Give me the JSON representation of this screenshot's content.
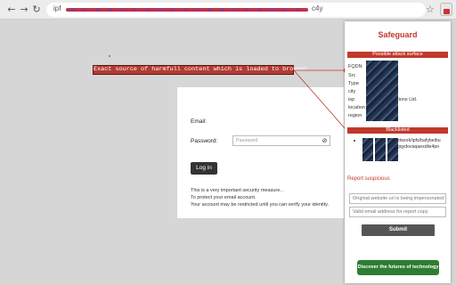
{
  "browser": {
    "back_icon": "back-arrow-icon",
    "forward_icon": "forward-arrow-icon",
    "reload_icon": "reload-icon",
    "address_prefix": "ipf",
    "address_suffix": "c4y",
    "star_icon": "star-icon",
    "extension_icon": "safeguard-extension-icon"
  },
  "overlay": {
    "banner_text": "Exact source of harmfull content which is loaded to browser",
    "banner_color": "#b33b32",
    "arrow_color": "#c0392b"
  },
  "login": {
    "email_label": "Email:",
    "password_label": "Password:",
    "password_placeholder": "Password",
    "eye_icon": "eye-slash-icon",
    "login_button": "Log in",
    "notice_lines": [
      "This is a very important security measure, .",
      "To protect your email account.",
      "Your account may be restricted until you can verify your identity."
    ]
  },
  "panel": {
    "title": "Safeguard",
    "accent_color": "#c0392b",
    "attack_surface_header": "Possible attack surface",
    "info_labels": [
      "FQDN",
      "Src",
      "Type",
      "city",
      "isp",
      "location",
      "region"
    ],
    "isp_value_tail": "ations Ltd.",
    "blacklisted_header": "Blacklisted",
    "blacklisted_lines": [
      "network/ipfs/bafybeibu",
      "ngqydovaqaexdiix4po"
    ],
    "report_label": "Report suspicious",
    "impersonated_placeholder": "Original website url is being impersonated",
    "email_placeholder": "Valid email address for report copy",
    "submit_button": "Submit",
    "discover_button": "Discover the futures of technology",
    "discover_color": "#2e7d32"
  }
}
